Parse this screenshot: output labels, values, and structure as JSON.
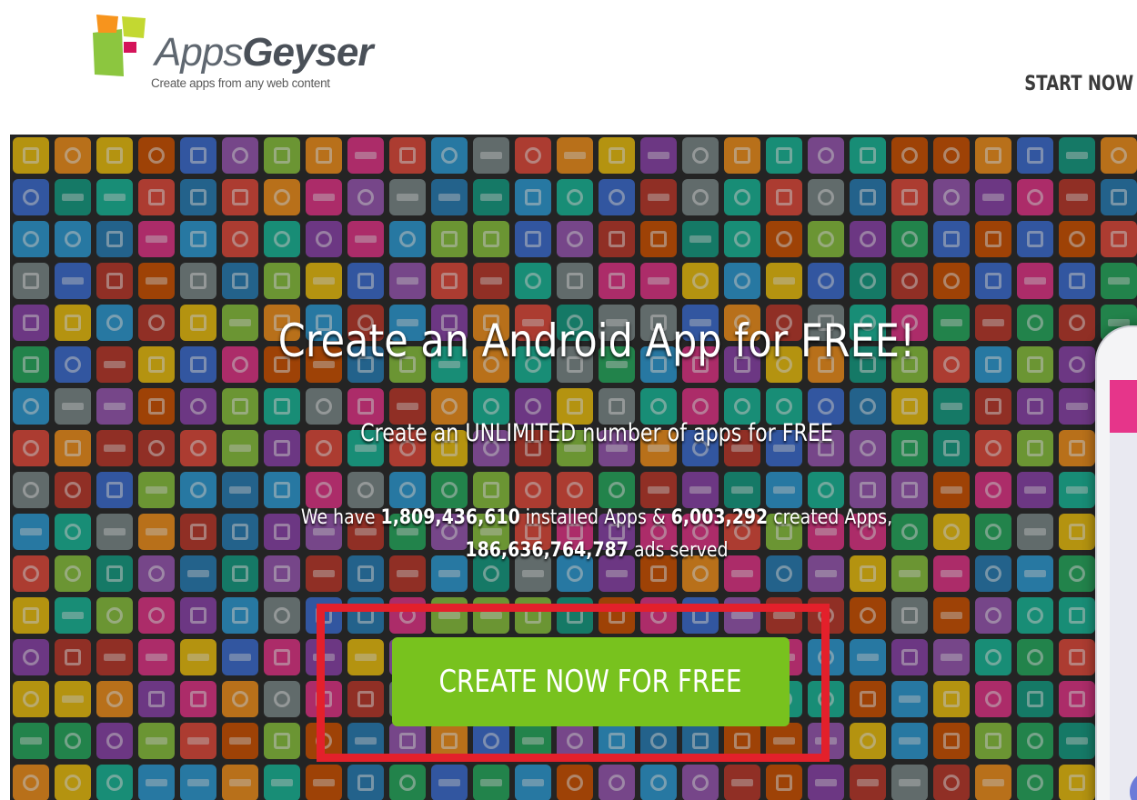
{
  "header": {
    "brand": {
      "name_light": "Apps",
      "name_bold": "Geyser",
      "tagline": "Create apps from any web content"
    },
    "nav": {
      "start_now": "START NOW"
    }
  },
  "hero": {
    "title": "Create an Android App for FREE!",
    "subtitle": "Create an UNLIMITED number of apps for FREE",
    "stats": {
      "prefix": "We have",
      "installed_count": "1,809,436,610",
      "installed_label": "installed Apps &",
      "created_count": "6,003,292",
      "created_label": "created Apps,",
      "ads_count": "186,636,764,787",
      "ads_label": "ads served"
    },
    "cta_label": "CREATE NOW FOR FREE"
  },
  "colors": {
    "cta": "#78c21e",
    "highlight_box": "#e3202b",
    "logo_green": "#8cc63f",
    "logo_orange": "#f7941d",
    "logo_magenta": "#d4145a"
  }
}
